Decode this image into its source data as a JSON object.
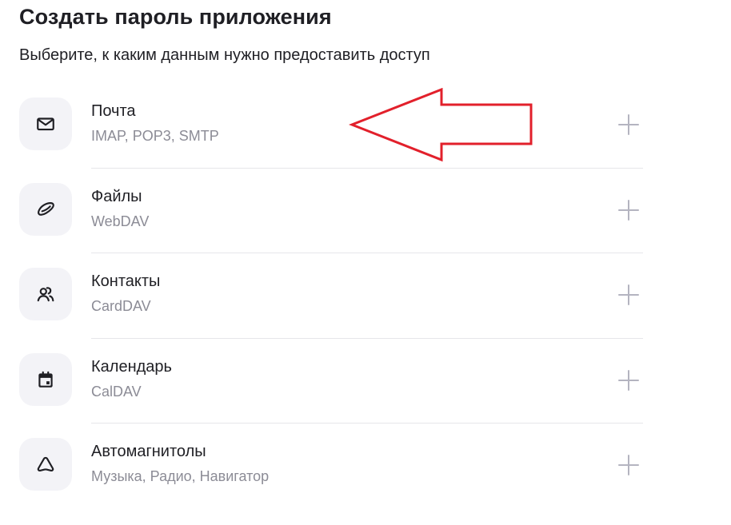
{
  "header": {
    "title": "Создать пароль приложения",
    "subtitle": "Выберите, к каким данным нужно предоставить доступ"
  },
  "items": [
    {
      "title": "Почта",
      "subtitle": "IMAP, POP3, SMTP",
      "icon": "mail-icon"
    },
    {
      "title": "Файлы",
      "subtitle": "WebDAV",
      "icon": "cloud-disk-icon"
    },
    {
      "title": "Контакты",
      "subtitle": "CardDAV",
      "icon": "contacts-icon"
    },
    {
      "title": "Календарь",
      "subtitle": "CalDAV",
      "icon": "calendar-icon"
    },
    {
      "title": "Автомагнитолы",
      "subtitle": "Музыка, Радио, Навигатор",
      "icon": "car-navigation-icon"
    }
  ],
  "colors": {
    "text": "#1f1f24",
    "secondary_text": "#8c8c96",
    "icon_tile": "#f3f3f7",
    "plus_icon": "#b4b4c0",
    "divider": "#e6e6ea",
    "annotation_arrow": "#e2202b"
  }
}
